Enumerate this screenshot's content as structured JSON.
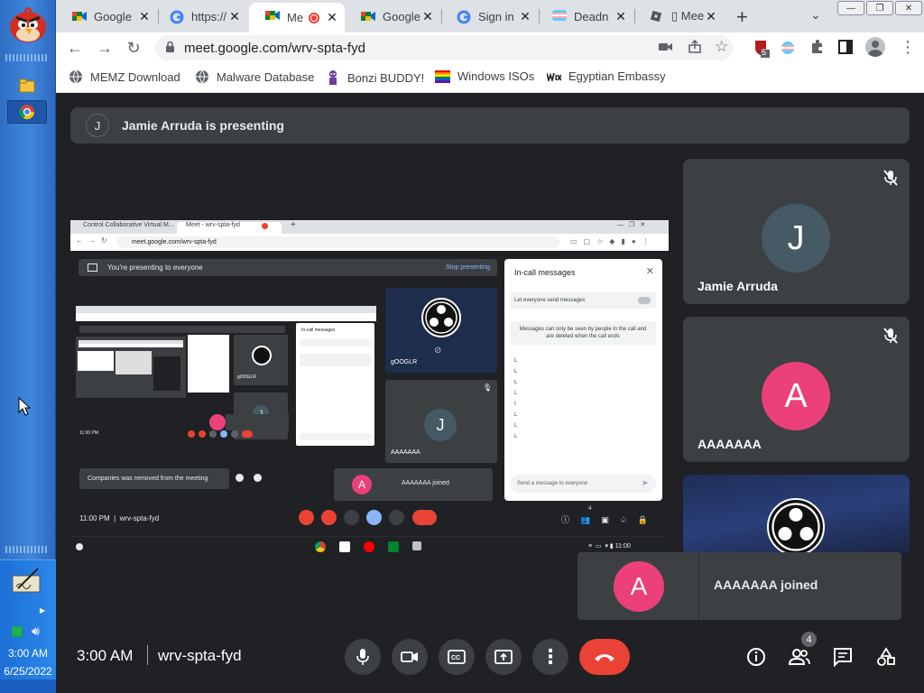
{
  "taskbar": {
    "time": "3:00 AM",
    "date": "6/25/2022"
  },
  "browser": {
    "tabs": [
      {
        "label": "Google",
        "active": false
      },
      {
        "label": "https://",
        "active": false
      },
      {
        "label": "Me",
        "active": true
      },
      {
        "label": "Google",
        "active": false
      },
      {
        "label": "Sign in",
        "active": false
      },
      {
        "label": "Deadn",
        "active": false
      },
      {
        "label": "▯ Mee",
        "active": false
      }
    ],
    "url": "meet.google.com/wrv-spta-fyd",
    "extension_badge": "5",
    "bookmarks": [
      "MEMZ Download",
      "Malware Database",
      "Bonzi BUDDY!",
      "Windows ISOs",
      "Egyptian Embassy"
    ]
  },
  "meet": {
    "presenting_initial": "J",
    "presenting_text": "Jamie Arruda is presenting",
    "participants": [
      {
        "name": "Jamie Arruda",
        "initial": "J",
        "color": "#455a64"
      },
      {
        "name": "AAAAAAA",
        "initial": "A",
        "color": "#ec407a"
      }
    ],
    "joined_toast": {
      "initial": "A",
      "text": "AAAAAAA joined"
    },
    "time": "3:00 AM",
    "meeting_code": "wrv-spta-fyd",
    "people_count": "4"
  },
  "screen_share": {
    "tabs": [
      "Control Collaborative Virtual M...",
      "Meet - wrv-spta-fyd"
    ],
    "url": "meet.google.com/wrv-spta-fyd",
    "presenting_text": "You're presenting to everyone",
    "stop_label": "Stop presenting",
    "panel_title": "In-call messages",
    "toggle_label": "Let everyone send messages",
    "note": "Messages can only be seen by people in the call and are deleted when the call ends",
    "message_lines": [
      "L",
      "L",
      "L",
      "L",
      "I",
      "L",
      "L",
      "L"
    ],
    "send_placeholder": "Send a message to everyone",
    "tile_names": [
      "gOOGLR",
      "AAAAAAA"
    ],
    "tile_initial": "J",
    "joined_initial": "A",
    "joined_text": "AAAAAAA joined",
    "removed_text": "Companies was removed from the meeting",
    "time": "11:00 PM",
    "code": "wrv-spta-fyd",
    "badge": "4",
    "shelf_time": "11:00"
  }
}
